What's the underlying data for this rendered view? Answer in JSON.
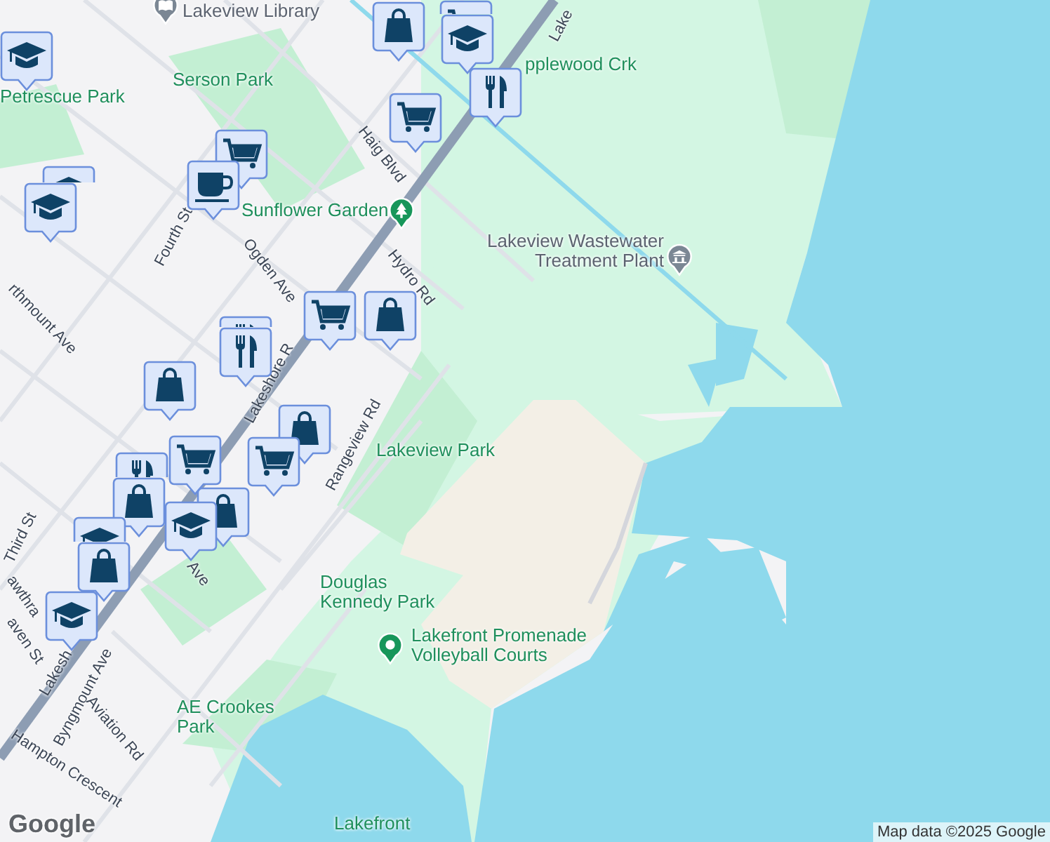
{
  "map": {
    "labels": [
      {
        "text": "Lakeview Library",
        "kind": "poi"
      },
      {
        "text": "Serson Park",
        "kind": "park"
      },
      {
        "text": "Petrescue Park",
        "kind": "park"
      },
      {
        "text": "pplewood Crk",
        "kind": "park"
      },
      {
        "text": "Haig Blvd",
        "kind": "street"
      },
      {
        "text": "Sunflower Garden",
        "kind": "park"
      },
      {
        "text": "Lakeview Wastewater Treatment Plant",
        "kind": "poi"
      },
      {
        "text": "Fourth St",
        "kind": "street"
      },
      {
        "text": "Ogden Ave",
        "kind": "street"
      },
      {
        "text": "Hydro Rd",
        "kind": "street"
      },
      {
        "text": "rthmount Ave",
        "kind": "street"
      },
      {
        "text": "Lakeshore R",
        "kind": "street"
      },
      {
        "text": "Rangeview Rd",
        "kind": "street"
      },
      {
        "text": "Lakeview Park",
        "kind": "park"
      },
      {
        "text": "Third St",
        "kind": "street"
      },
      {
        "text": "awthra",
        "kind": "street"
      },
      {
        "text": "aven St",
        "kind": "street"
      },
      {
        "text": "Byngmount Ave",
        "kind": "street"
      },
      {
        "text": "Aviation Rd",
        "kind": "street"
      },
      {
        "text": "Hampton Crescent",
        "kind": "street"
      },
      {
        "text": "Lakesh",
        "kind": "street"
      },
      {
        "text": "Ave",
        "kind": "street"
      },
      {
        "text": "Douglas Kennedy Park",
        "kind": "park"
      },
      {
        "text": "Lakefront Promenade Volleyball Courts",
        "kind": "park"
      },
      {
        "text": "AE Crookes Park",
        "kind": "park"
      },
      {
        "text": "Lakefront",
        "kind": "park"
      },
      {
        "text": "Lake",
        "kind": "street"
      }
    ],
    "pins": [
      {
        "kind": "library"
      },
      {
        "kind": "tree"
      },
      {
        "kind": "building"
      },
      {
        "kind": "place"
      }
    ],
    "markers": [
      {
        "kind": "school"
      },
      {
        "kind": "bag"
      },
      {
        "kind": "cart"
      },
      {
        "kind": "school"
      },
      {
        "kind": "food"
      },
      {
        "kind": "cart"
      },
      {
        "kind": "cart"
      },
      {
        "kind": "cafe"
      },
      {
        "kind": "school"
      },
      {
        "kind": "school"
      },
      {
        "kind": "cart"
      },
      {
        "kind": "bag"
      },
      {
        "kind": "food"
      },
      {
        "kind": "food"
      },
      {
        "kind": "bag"
      },
      {
        "kind": "bag"
      },
      {
        "kind": "cart"
      },
      {
        "kind": "cart"
      },
      {
        "kind": "food"
      },
      {
        "kind": "bag"
      },
      {
        "kind": "bag"
      },
      {
        "kind": "school"
      },
      {
        "kind": "school"
      },
      {
        "kind": "bag"
      },
      {
        "kind": "school"
      }
    ],
    "logo": "Google",
    "attribution": "Map data ©2025 Google"
  }
}
